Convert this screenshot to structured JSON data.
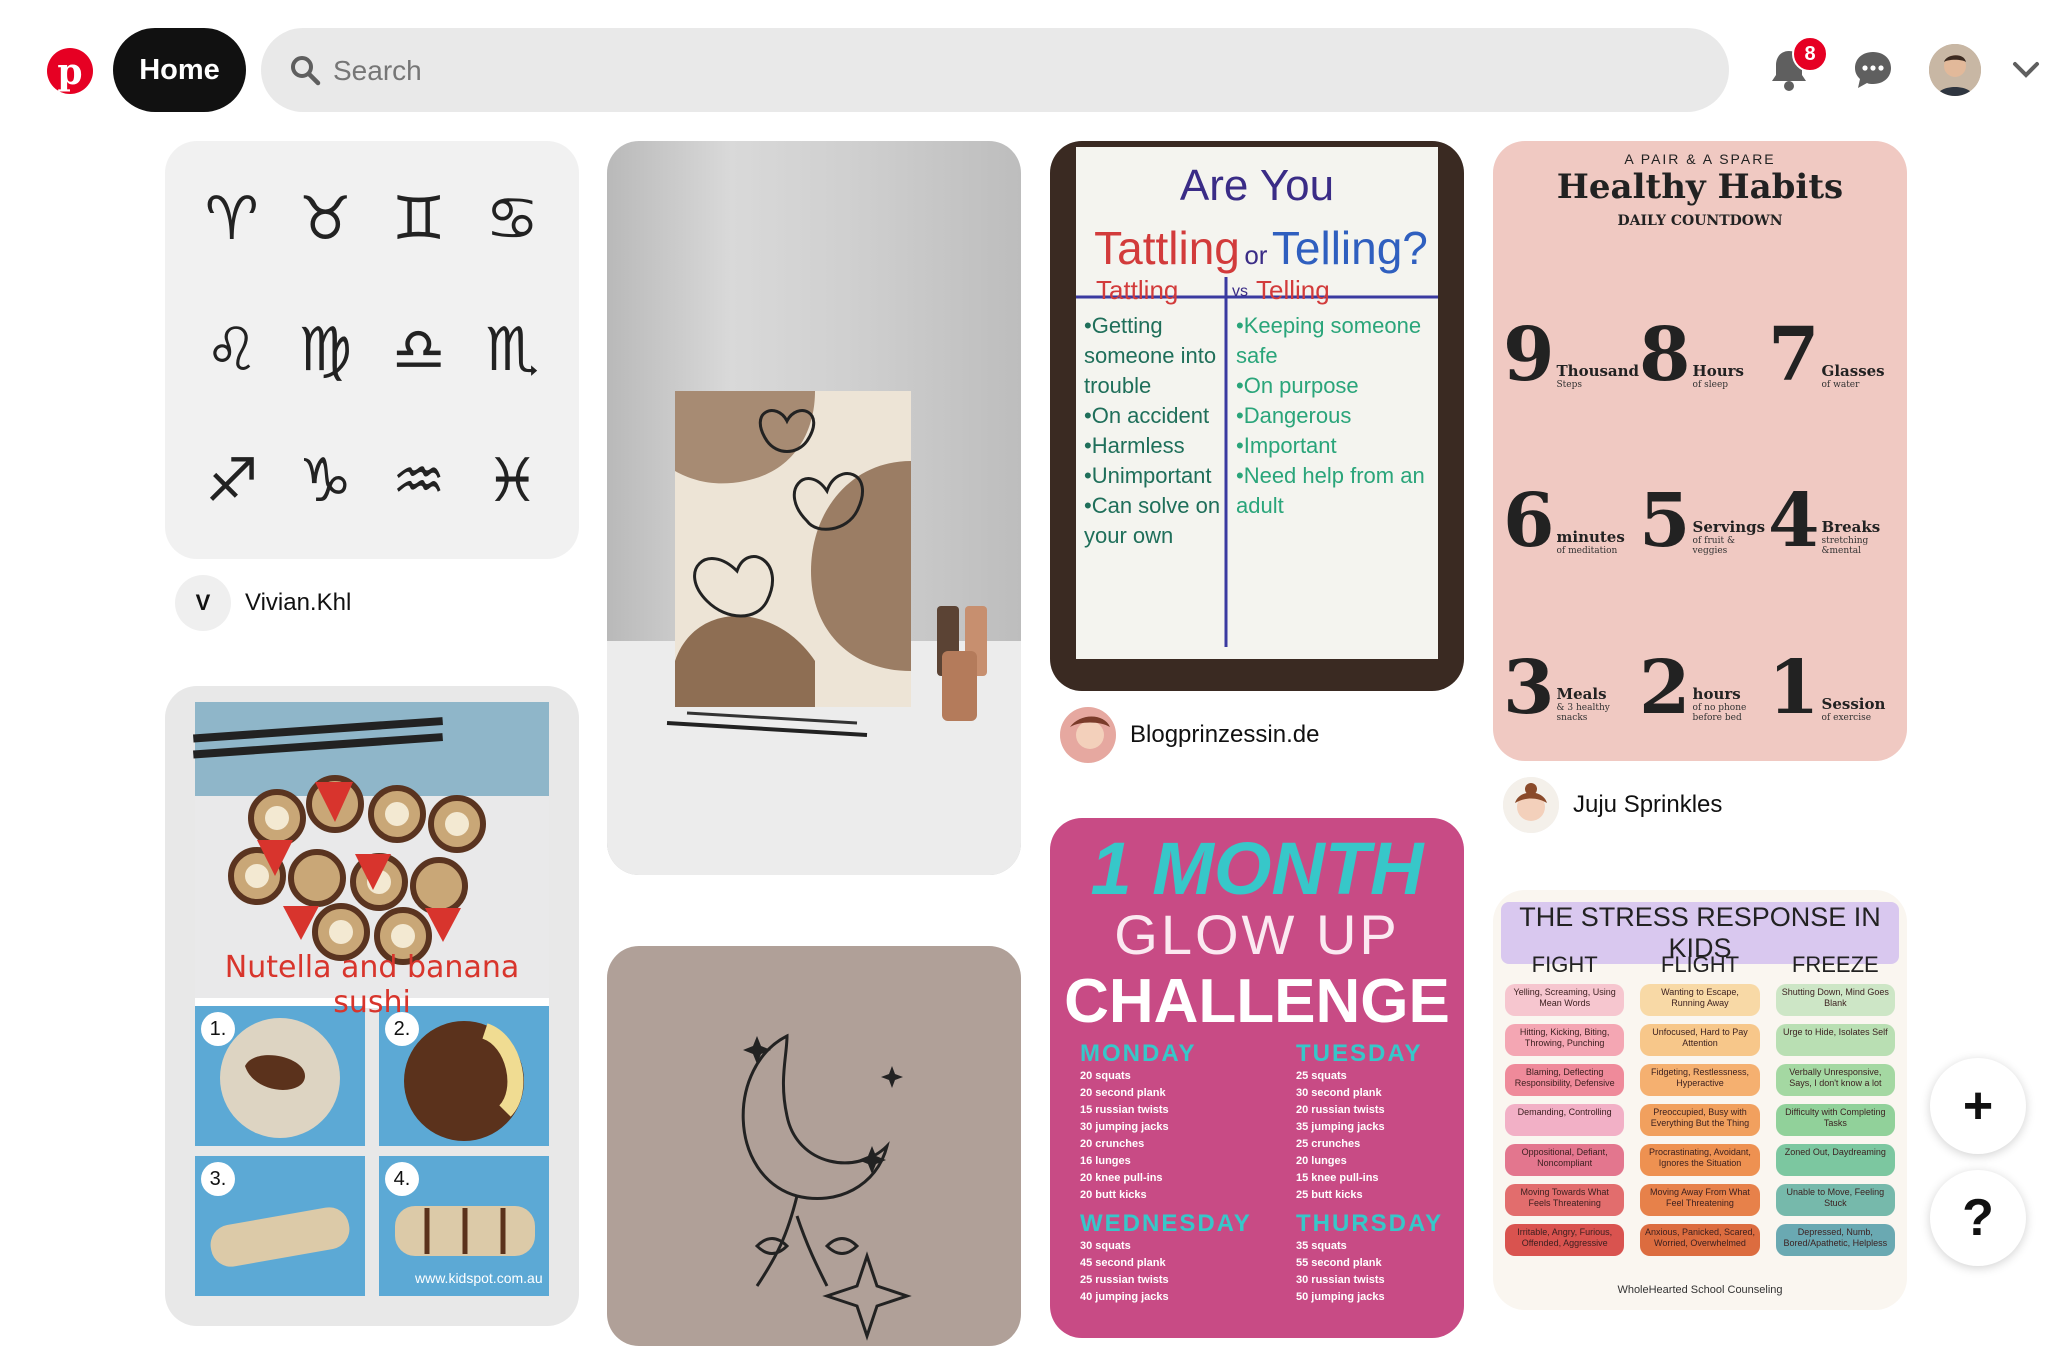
{
  "header": {
    "logo_icon": "pinterest-logo",
    "home_label": "Home",
    "search_placeholder": "Search",
    "notification_count": "8",
    "brand_color": "#e60023"
  },
  "pins": [
    {
      "id": "zodiac",
      "alt": "Floral zodiac sign line drawings",
      "author": "Vivian.Khl",
      "author_initial": "V"
    },
    {
      "id": "canvas",
      "alt": "Butterfly canvas painting with paint bottles"
    },
    {
      "id": "tattle",
      "alt": "Are You Tattling or Telling? anchor chart",
      "author": "Blogprinzessin.de",
      "title_are": "Are You",
      "title_tattling": "Tattling",
      "title_or": "or",
      "title_telling": "Telling?",
      "col_left": "Tattling",
      "col_vs": "vs",
      "col_right": "Telling",
      "left_items": [
        "•Getting someone into trouble",
        "•On accident",
        "•Harmless",
        "•Unimportant",
        "•Can solve on your own"
      ],
      "right_items": [
        "•Keeping someone safe",
        "•On purpose",
        "•Dangerous",
        "•Important",
        "•Need help from an adult"
      ]
    },
    {
      "id": "habits",
      "alt": "Healthy Habits Daily Countdown",
      "author": "Juju Sprinkles",
      "kicker": "A PAIR & A SPARE",
      "title": "Healthy Habits",
      "subtitle": "DAILY COUNTDOWN",
      "items": [
        {
          "n": "9",
          "l": "Thousand",
          "s": "Steps"
        },
        {
          "n": "8",
          "l": "Hours",
          "s": "of sleep"
        },
        {
          "n": "7",
          "l": "Glasses",
          "s": "of water"
        },
        {
          "n": "6",
          "l": "minutes",
          "s": "of meditation"
        },
        {
          "n": "5",
          "l": "Servings",
          "s": "of fruit & veggies"
        },
        {
          "n": "4",
          "l": "Breaks",
          "s": "stretching &mental"
        },
        {
          "n": "3",
          "l": "Meals",
          "s": "& 3 healthy snacks"
        },
        {
          "n": "2",
          "l": "hours",
          "s": "of no phone before bed"
        },
        {
          "n": "1",
          "l": "Session",
          "s": "of exercise"
        }
      ]
    },
    {
      "id": "nutella",
      "alt": "Nutella and banana sushi recipe",
      "caption": "Nutella and banana sushi",
      "steps": [
        "1.",
        "2.",
        "3.",
        "4."
      ],
      "credit": "www.kidspot.com.au"
    },
    {
      "id": "moon",
      "alt": "Line drawing of crescent moon with flowers"
    },
    {
      "id": "glow",
      "alt": "1 Month Glow Up Challenge",
      "line1": "1 MONTH",
      "line2": "GLOW UP",
      "line3": "CHALLENGE",
      "days": [
        {
          "d": "MONDAY",
          "items": [
            "20 squats",
            "20 second plank",
            "15 russian twists",
            "30 jumping jacks",
            "20 crunches",
            "16 lunges",
            "20 knee pull-ins",
            "20 butt kicks"
          ]
        },
        {
          "d": "TUESDAY",
          "items": [
            "25 squats",
            "30 second plank",
            "20 russian twists",
            "35 jumping jacks",
            "25 crunches",
            "20 lunges",
            "15 knee pull-ins",
            "25 butt kicks"
          ]
        },
        {
          "d": "WEDNESDAY",
          "items": [
            "30 squats",
            "45 second plank",
            "25 russian twists",
            "40 jumping jacks"
          ]
        },
        {
          "d": "THURSDAY",
          "items": [
            "35 squats",
            "55 second plank",
            "30 russian twists",
            "50 jumping jacks"
          ]
        }
      ]
    },
    {
      "id": "stress",
      "alt": "The Stress Response in Kids",
      "title": "THE STRESS RESPONSE IN KIDS",
      "cols": [
        {
          "h": "FIGHT",
          "items": [
            "Yelling, Screaming, Using Mean Words",
            "Hitting, Kicking, Biting, Throwing, Punching",
            "Blaming, Deflecting Responsibility, Defensive",
            "Demanding, Controlling",
            "Oppositional, Defiant, Noncompliant",
            "Moving Towards What Feels Threatening",
            "Irritable, Angry, Furious, Offended, Aggressive"
          ]
        },
        {
          "h": "FLIGHT",
          "items": [
            "Wanting to Escape, Running Away",
            "Unfocused, Hard to Pay Attention",
            "Fidgeting, Restlessness, Hyperactive",
            "Preoccupied, Busy with Everything But the Thing",
            "Procrastinating, Avoidant, Ignores the Situation",
            "Moving Away From What Feel Threatening",
            "Anxious, Panicked, Scared, Worried, Overwhelmed"
          ]
        },
        {
          "h": "FREEZE",
          "items": [
            "Shutting Down, Mind Goes Blank",
            "Urge to Hide, Isolates Self",
            "Verbally Unresponsive, Says, I don't know a lot",
            "Difficulty with Completing Tasks",
            "Zoned Out, Daydreaming",
            "Unable to Move, Feeling Stuck",
            "Depressed, Numb, Bored/Apathetic, Helpless"
          ]
        }
      ],
      "credit": "WholeHearted School Counseling"
    }
  ],
  "fab": {
    "plus": "+",
    "help": "?"
  }
}
